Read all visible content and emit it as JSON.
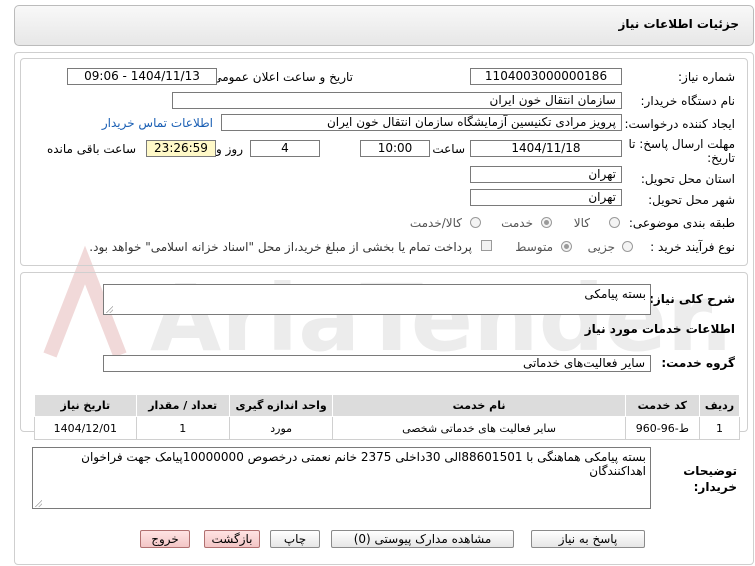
{
  "header": {
    "title": "جزئیات اطلاعات نیاز"
  },
  "watermark": {
    "text": "AriaTender.net"
  },
  "form": {
    "need_number_label": "شماره نیاز:",
    "need_number": "1104003000000186",
    "announce_label": "تاریخ و ساعت اعلان عمومی:",
    "announce_value": "1404/11/13 - 09:06",
    "buyer_org_label": "نام دستگاه خریدار:",
    "buyer_org": "سازمان انتقال خون ایران",
    "creator_label": "ایجاد کننده درخواست:",
    "creator": "پرویز مرادی تکنیسین آزمایشگاه سازمان انتقال خون ایران",
    "contact_link": "اطلاعات تماس خریدار",
    "deadline_label_1": "مهلت ارسال پاسخ: تا",
    "deadline_label_2": "تاریخ:",
    "deadline_date": "1404/11/18",
    "time_label": "ساعت",
    "deadline_time": "10:00",
    "days_value": "4",
    "days_label": "روز و",
    "remaining_time": "23:26:59",
    "remaining_label": "ساعت باقی مانده",
    "province_label": "استان محل تحویل:",
    "province": "تهران",
    "city_label": "شهر محل تحویل:",
    "city": "تهران",
    "category_label": "طبقه بندی موضوعی:",
    "category_options": [
      "کالا",
      "خدمت",
      "کالا/خدمت"
    ],
    "category_selected": "خدمت",
    "process_label": "نوع فرآیند خرید :",
    "process_options": [
      "جزیی",
      "متوسط"
    ],
    "process_selected": "متوسط",
    "payment_note": "پرداخت تمام یا بخشی از مبلغ خرید،از محل \"اسناد خزانه اسلامی\" خواهد بود."
  },
  "summary": {
    "label": "شرح کلی نیاز:",
    "value": "بسته پیامکی"
  },
  "services": {
    "section_title": "اطلاعات خدمات مورد نیاز",
    "group_label": "گروه خدمت:",
    "group_value": "سایر فعالیت‌های خدماتی",
    "table": {
      "headers": [
        "ردیف",
        "کد خدمت",
        "نام خدمت",
        "واحد اندازه گیری",
        "تعداد / مقدار",
        "تاریخ نیاز"
      ],
      "rows": [
        [
          "1",
          "ط-96-960",
          "سایر فعالیت های خدماتی شخصی",
          "مورد",
          "1",
          "1404/12/01"
        ]
      ]
    }
  },
  "buyer_notes": {
    "label_1": "توضیحات",
    "label_2": "خریدار:",
    "value": "بسته پیامکی هماهنگی با 88601501الی 30داخلی 2375 خانم نعمتی درخصوص 10000000پیامک جهت فراخوان اهداکنندگان"
  },
  "buttons": {
    "reply": "پاسخ به نیاز",
    "attachments": "مشاهده مدارک پیوستی (0)",
    "print": "چاپ",
    "back": "بازگشت",
    "exit": "خروج"
  }
}
